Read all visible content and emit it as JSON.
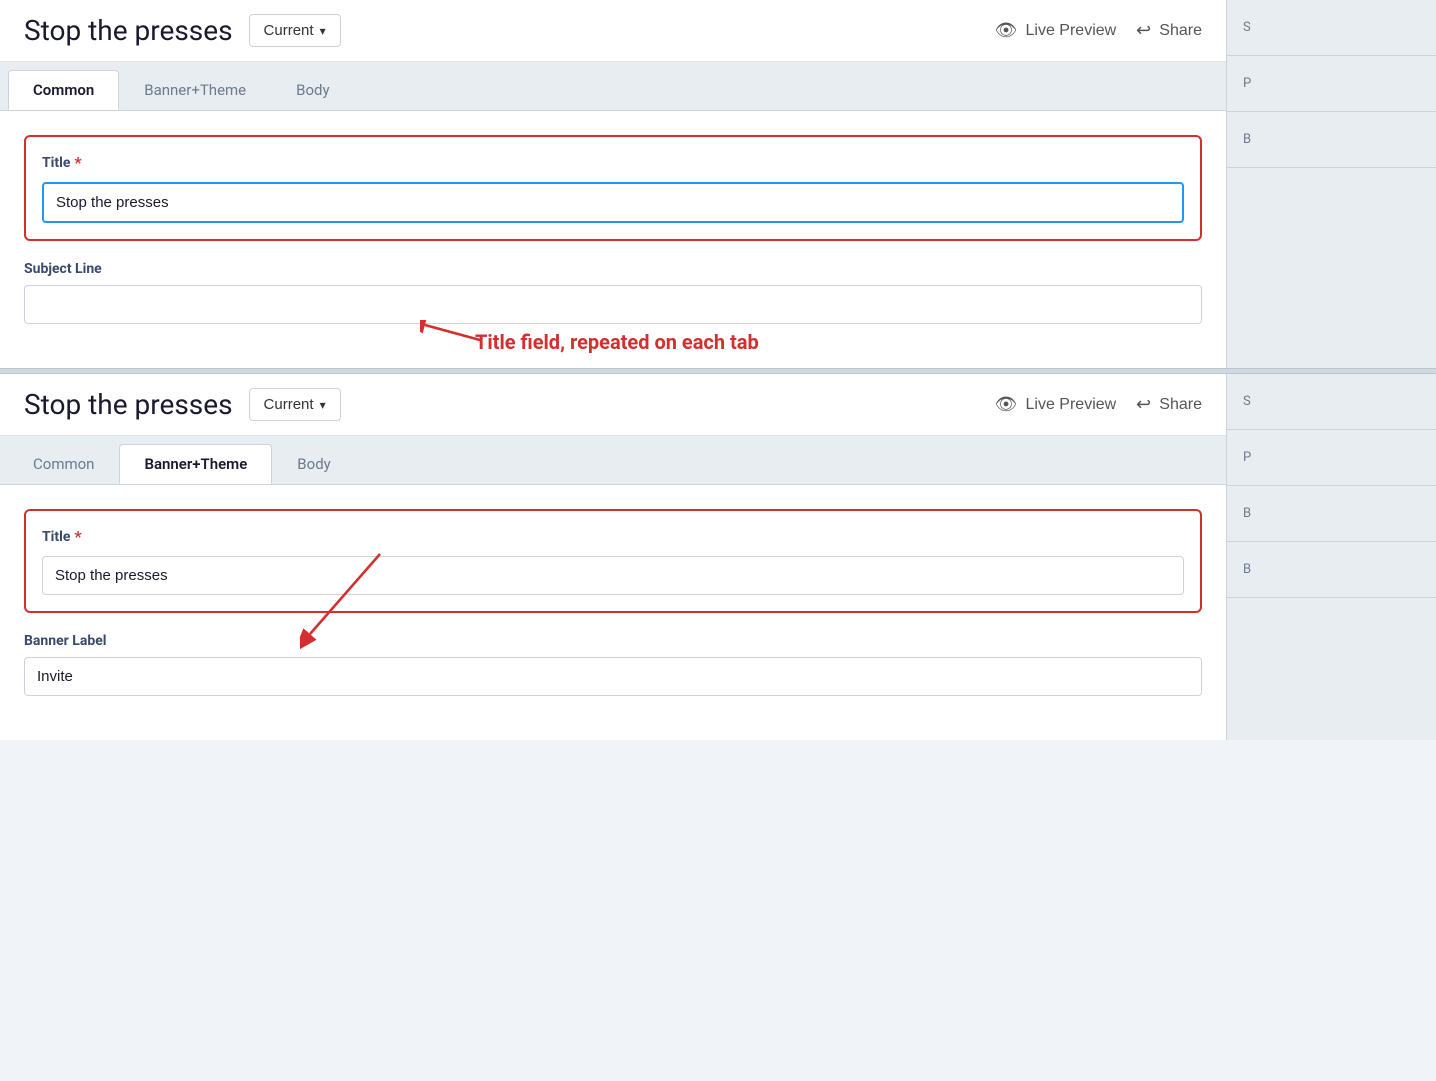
{
  "app": {
    "title": "Stop the presses"
  },
  "topPanel": {
    "header": {
      "title": "Stop the presses",
      "currentBtn": "Current",
      "chevron": "▾",
      "livePreview": "Live Preview",
      "share": "Share"
    },
    "tabs": [
      {
        "label": "Common",
        "active": true
      },
      {
        "label": "Banner+Theme",
        "active": false
      },
      {
        "label": "Body",
        "active": false
      }
    ],
    "titleField": {
      "label": "Title",
      "required": true,
      "value": "Stop the presses"
    },
    "subjectField": {
      "label": "Subject Line",
      "value": ""
    }
  },
  "bottomPanel": {
    "header": {
      "title": "Stop the presses",
      "currentBtn": "Current",
      "chevron": "▾",
      "livePreview": "Live Preview",
      "share": "Share"
    },
    "tabs": [
      {
        "label": "Common",
        "active": false
      },
      {
        "label": "Banner+Theme",
        "active": true
      },
      {
        "label": "Body",
        "active": false
      }
    ],
    "titleField": {
      "label": "Title",
      "required": true,
      "value": "Stop the presses"
    },
    "bannerField": {
      "label": "Banner Label",
      "value": "Invite"
    }
  },
  "annotation": {
    "text": "Title field, repeated on each tab"
  },
  "sidebar": {
    "items": [
      "S",
      "P",
      "B",
      "B",
      "B"
    ]
  },
  "icons": {
    "eye": "👁",
    "share": "↪",
    "chevron": "∨"
  }
}
